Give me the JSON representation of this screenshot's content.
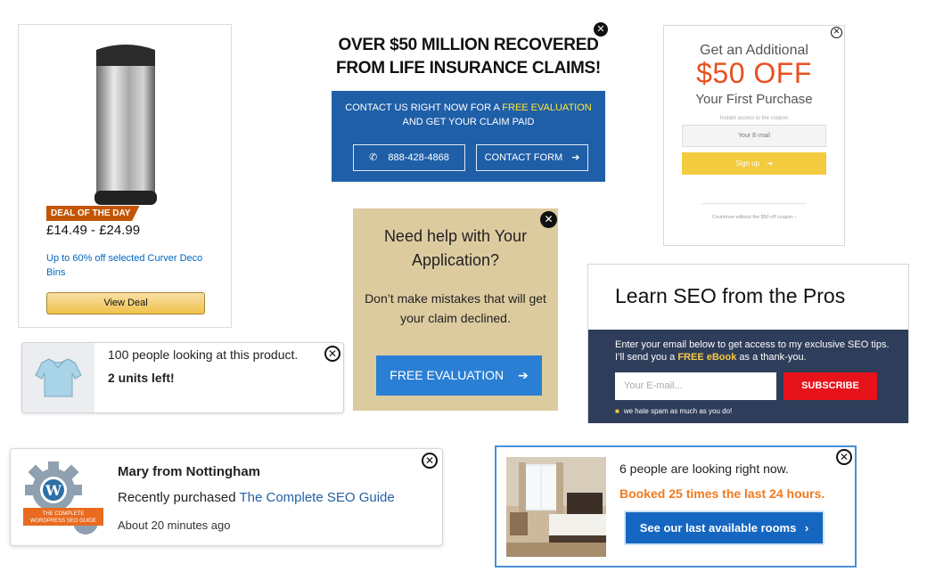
{
  "deal_card": {
    "badge": "DEAL OF THE DAY",
    "price": "£14.49 - £24.99",
    "promo": "Up to 60% off selected Curver Deco Bins",
    "button": "View Deal"
  },
  "insurance": {
    "headline_1": "OVER $50 MILLION RECOVERED",
    "headline_2": "FROM LIFE INSURANCE CLAIMS!",
    "panel_text_1": "CONTACT US RIGHT NOW  FOR A ",
    "panel_highlight": "FREE EVALUATION",
    "panel_text_2": "AND GET YOUR CLAIM PAID",
    "phone_button": "888-428-4868",
    "form_button": "CONTACT FORM",
    "close": "✕"
  },
  "coupon": {
    "title_1": "Get an Additional",
    "title_2": "$50 OFF",
    "title_3": "Your First Purchase",
    "instant_note": "Instant access to the coupon",
    "email_placeholder": "Your E-mail",
    "signup_button": "Sign up",
    "continue_link": "Countinue without the $50 off coupon",
    "close": "✕"
  },
  "help_box": {
    "title": "Need help with Your Application?",
    "body": "Don’t make mistakes that will get your claim declined.",
    "cta": "FREE EVALUATION",
    "close": "✕"
  },
  "seo_box": {
    "title": "Learn SEO from the Pros",
    "desc_1": "Enter your email below to get access to my exclusive SEO tips. I’ll send you a ",
    "desc_highlight": "FREE eBook",
    "desc_2": " as a thank-you.",
    "email_placeholder": "Your E-mail...",
    "subscribe_button": "SUBSCRIBE",
    "spam_note": "we hate spam as much as you do!"
  },
  "looking": {
    "line_1": "100 people looking at this product.",
    "line_2": "2 units left!",
    "close": "✕"
  },
  "purchase": {
    "name": "Mary from Nottingham",
    "action": "Recently purchased ",
    "product": "The Complete SEO Guide",
    "time": "About 20 minutes ago",
    "logo_banner_1": "THE COMPLETE",
    "logo_banner_2": "WORDPRESS SEO GUIDE",
    "close": "✕"
  },
  "hotel": {
    "line_1": "6 people are looking right now.",
    "line_2": "Booked 25 times the last 24 hours.",
    "button": "See our last available rooms",
    "close": "✕"
  }
}
